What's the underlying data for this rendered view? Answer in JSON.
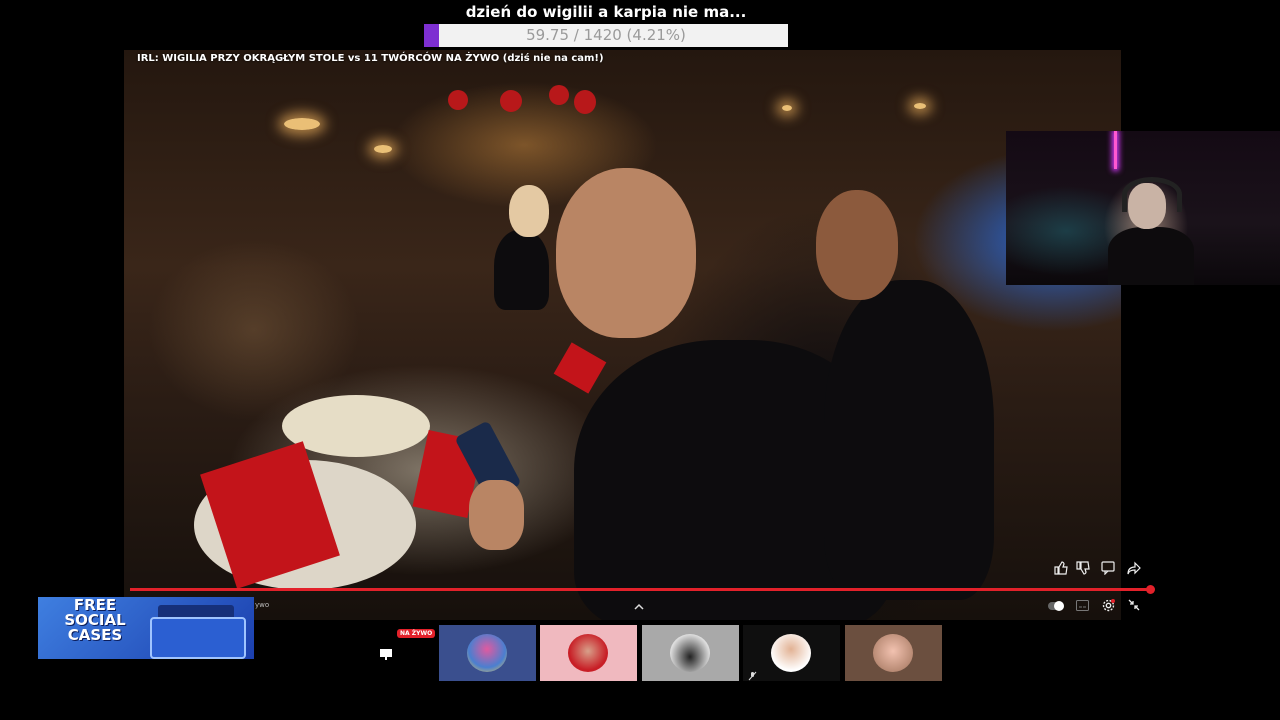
{
  "overlay": {
    "title": "dzień do wigilii a karpia nie ma...",
    "goal_text": "59.75 / 1420 (4.21%)",
    "goal_progress_percent": 4.21
  },
  "video": {
    "title": "IRL: WIGILIA PRZY OKRĄGŁYM STOLE vs 11 TWÓRCÓW NA ŻYWO (dziś nie na cam!)",
    "progress_percent": 99.5
  },
  "controls": {
    "like_icon": "thumb-up-icon",
    "dislike_icon": "thumb-down-icon",
    "comments_icon": "comment-icon",
    "share_icon": "share-icon",
    "expand_icon": "chevron-up-icon",
    "autoplay_icon": "autoplay-toggle-icon",
    "captions_icon": "captions-icon",
    "settings_icon": "gear-icon",
    "minimize_icon": "collapse-icon"
  },
  "sponsor": {
    "line1": "FREE",
    "line2": "SOCIAL",
    "line3": "CASES",
    "sub": "ywo"
  },
  "dock": {
    "live_badge": "NA ŻYWO",
    "items": [
      {
        "name": "stream",
        "icon": "monitor-icon"
      },
      {
        "name": "creator-1"
      },
      {
        "name": "creator-2"
      },
      {
        "name": "creator-3"
      },
      {
        "name": "creator-4",
        "icon": "muted-icon"
      },
      {
        "name": "creator-5"
      }
    ]
  },
  "colors": {
    "accent_red": "#e2212a",
    "goal_fill": "#7d2fd1"
  }
}
